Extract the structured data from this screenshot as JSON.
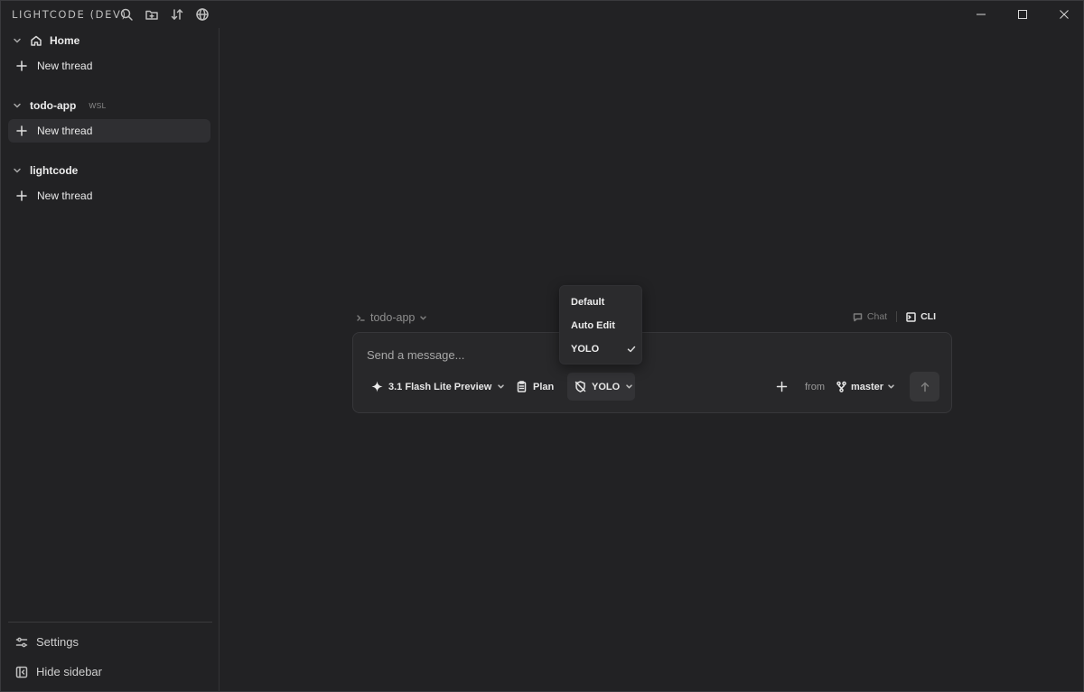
{
  "window": {
    "title": "LIGHTCODE (DEV)",
    "title_icons": [
      "search-icon",
      "folder-plus-icon",
      "sort-icon",
      "globe-icon"
    ],
    "controls": [
      "minimize-icon",
      "maximize-icon",
      "close-icon"
    ]
  },
  "sidebar": {
    "groups": [
      {
        "label": "Home",
        "badge": "",
        "icon": "home-icon",
        "items": [
          {
            "label": "New thread",
            "active": false
          }
        ]
      },
      {
        "label": "todo-app",
        "badge": "WSL",
        "icon": "",
        "items": [
          {
            "label": "New thread",
            "active": true
          }
        ]
      },
      {
        "label": "lightcode",
        "badge": "",
        "icon": "",
        "items": [
          {
            "label": "New thread",
            "active": false
          }
        ]
      }
    ],
    "footer": {
      "settings_label": "Settings",
      "hide_sidebar_label": "Hide sidebar"
    }
  },
  "composer": {
    "project_label": "todo-app",
    "mode_chat_label": "Chat",
    "mode_cli_label": "CLI",
    "active_mode": "CLI",
    "placeholder": "Send a message...",
    "model_label": "3.1 Flash Lite Preview",
    "plan_label": "Plan",
    "approval_label": "YOLO",
    "from_label": "from",
    "branch_label": "master"
  },
  "approval_dropdown": {
    "options": [
      {
        "label": "Default",
        "selected": false
      },
      {
        "label": "Auto Edit",
        "selected": false
      },
      {
        "label": "YOLO",
        "selected": true
      }
    ]
  },
  "colors": {
    "background": "#222224",
    "panel": "#28282a",
    "active_item": "#2f2f32",
    "text": "#e6e6e6",
    "muted": "#9a9a9a"
  }
}
